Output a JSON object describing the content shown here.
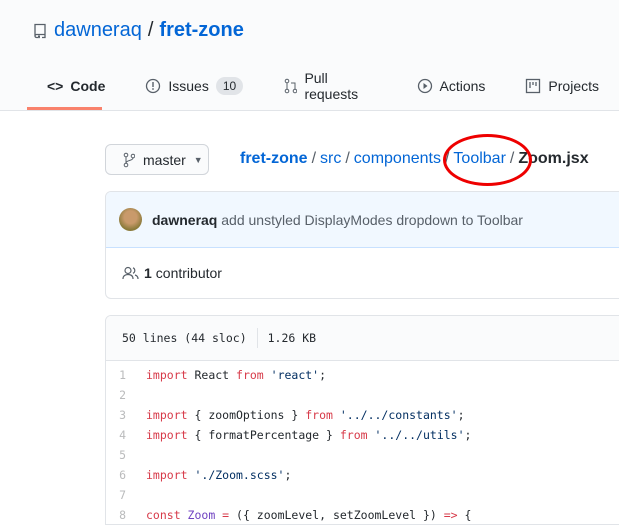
{
  "repo": {
    "owner": "dawneraq",
    "sep": "/",
    "name": "fret-zone"
  },
  "tabs": [
    {
      "label": "Code",
      "icon": "code-icon"
    },
    {
      "label": "Issues",
      "icon": "issue-icon",
      "count": "10"
    },
    {
      "label": "Pull requests",
      "icon": "pull-request-icon"
    },
    {
      "label": "Actions",
      "icon": "play-icon"
    },
    {
      "label": "Projects",
      "icon": "project-icon"
    }
  ],
  "branch": {
    "label": "master"
  },
  "breadcrumb": {
    "items": [
      "fret-zone",
      "src",
      "components",
      "Toolbar"
    ],
    "sep": "/",
    "file": "Zoom.jsx"
  },
  "commit": {
    "author": "dawneraq",
    "message": "add unstyled DisplayModes dropdown to Toolbar"
  },
  "contributors": {
    "count": "1",
    "label": "contributor"
  },
  "file": {
    "lines": "50 lines (44 sloc)",
    "size": "1.26 KB"
  },
  "code": [
    [
      {
        "t": "import",
        "c": "k"
      },
      {
        "t": " React ",
        "c": "p"
      },
      {
        "t": "from",
        "c": "k"
      },
      {
        "t": " 'react'",
        "c": "s"
      },
      {
        "t": ";",
        "c": "p"
      }
    ],
    [],
    [
      {
        "t": "import",
        "c": "k"
      },
      {
        "t": " { zoomOptions } ",
        "c": "p"
      },
      {
        "t": "from",
        "c": "k"
      },
      {
        "t": " '../../constants'",
        "c": "s"
      },
      {
        "t": ";",
        "c": "p"
      }
    ],
    [
      {
        "t": "import",
        "c": "k"
      },
      {
        "t": " { formatPercentage } ",
        "c": "p"
      },
      {
        "t": "from",
        "c": "k"
      },
      {
        "t": " '../../utils'",
        "c": "s"
      },
      {
        "t": ";",
        "c": "p"
      }
    ],
    [],
    [
      {
        "t": "import",
        "c": "k"
      },
      {
        "t": " './Zoom.scss'",
        "c": "s"
      },
      {
        "t": ";",
        "c": "p"
      }
    ],
    [],
    [
      {
        "t": "const",
        "c": "k"
      },
      {
        "t": " Zoom",
        "c": "e"
      },
      {
        "t": " = ",
        "c": "k"
      },
      {
        "t": "({ zoomLevel, setZoomLevel }) ",
        "c": "p"
      },
      {
        "t": "=>",
        "c": "k"
      },
      {
        "t": " {",
        "c": "p"
      }
    ]
  ],
  "colors": {
    "link": "#0366d6",
    "tab_underline": "#f9826c",
    "annotation": "#ee0000"
  }
}
